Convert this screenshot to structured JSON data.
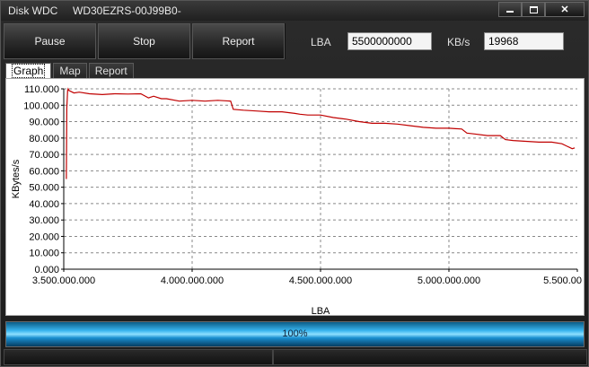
{
  "window": {
    "title": "Disk WDC     WD30EZRS-00J99B0-",
    "controls": [
      "minimize",
      "maximize",
      "close"
    ]
  },
  "toolbar": {
    "pause_label": "Pause",
    "stop_label": "Stop",
    "report_label": "Report",
    "lba_label": "LBA",
    "lba_value": "5500000000",
    "kbs_label": "KB/s",
    "kbs_value": "19968"
  },
  "tabs": [
    {
      "label": "Graph",
      "active": true
    },
    {
      "label": "Map",
      "active": false
    },
    {
      "label": "Report",
      "active": false
    }
  ],
  "progress": {
    "label": "100%",
    "fraction": 1.0
  },
  "chart_data": {
    "type": "line",
    "xlabel": "LBA",
    "ylabel": "KBytes/s",
    "xlim": [
      3500000000,
      5500000000
    ],
    "ylim": [
      0,
      110000
    ],
    "x_ticks": [
      3500000000,
      4000000000,
      4500000000,
      5000000000,
      5500000000
    ],
    "x_tick_labels": [
      "3.500.000.000",
      "4.000.000.000",
      "4.500.000.000",
      "5.000.000.000",
      "5.500.00"
    ],
    "y_ticks": [
      0,
      10000,
      20000,
      30000,
      40000,
      50000,
      60000,
      70000,
      80000,
      90000,
      100000,
      110000
    ],
    "y_tick_labels": [
      "0.000",
      "10.000",
      "20.000",
      "30.000",
      "40.000",
      "50.000",
      "60.000",
      "70.000",
      "80.000",
      "90.000",
      "100.000",
      "110.000"
    ],
    "grid": true,
    "series": [
      {
        "color": "#c00000",
        "x": [
          3510000000,
          3512000000,
          3515000000,
          3517000000,
          3520000000,
          3540000000,
          3560000000,
          3600000000,
          3650000000,
          3700000000,
          3750000000,
          3800000000,
          3830000000,
          3850000000,
          3880000000,
          3900000000,
          3950000000,
          4000000000,
          4050000000,
          4100000000,
          4150000000,
          4160000000,
          4200000000,
          4250000000,
          4300000000,
          4350000000,
          4400000000,
          4420000000,
          4450000000,
          4500000000,
          4550000000,
          4600000000,
          4650000000,
          4700000000,
          4750000000,
          4800000000,
          4850000000,
          4900000000,
          4950000000,
          5000000000,
          5050000000,
          5070000000,
          5100000000,
          5150000000,
          5200000000,
          5220000000,
          5250000000,
          5300000000,
          5350000000,
          5400000000,
          5440000000,
          5460000000,
          5480000000,
          5490000000
        ],
        "y": [
          55000,
          98000,
          109000,
          110000,
          109000,
          107500,
          108000,
          107000,
          106500,
          107000,
          106800,
          107000,
          104500,
          105500,
          104000,
          104000,
          102500,
          103000,
          102500,
          103000,
          102500,
          97500,
          97000,
          96500,
          96000,
          96000,
          95000,
          94500,
          94000,
          94000,
          92500,
          91500,
          90000,
          89000,
          89000,
          88500,
          87500,
          86500,
          86000,
          86000,
          85500,
          83000,
          82500,
          81500,
          81500,
          79000,
          78500,
          78000,
          77500,
          77500,
          76500,
          75000,
          73500,
          74000
        ]
      }
    ]
  }
}
